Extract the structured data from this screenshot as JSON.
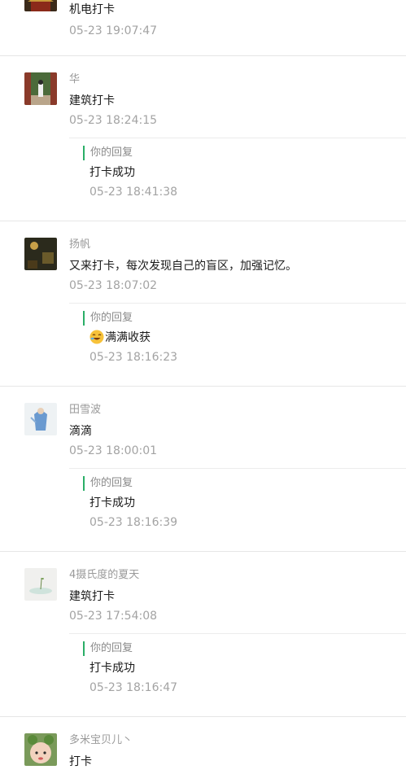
{
  "comments": [
    {
      "nickname": "",
      "text": "机电打卡",
      "time": "05-23 19:07:47",
      "avatar": "palace-avatar"
    },
    {
      "nickname": "华",
      "text": "建筑打卡",
      "time": "05-23 18:24:15",
      "reply": {
        "label": "你的回复",
        "text": "打卡成功",
        "time": "05-23 18:41:38"
      },
      "avatar": "corridor-avatar"
    },
    {
      "nickname": "扬帆",
      "text": "又来打卡，每次发现自己的盲区，加强记忆。",
      "time": "05-23 18:07:02",
      "reply": {
        "label": "你的回复",
        "text": "满满收获",
        "emoji": "laughing-emoji-icon",
        "time": "05-23 18:16:23"
      },
      "avatar": "night-avatar"
    },
    {
      "nickname": "田雪波",
      "text": "滴滴",
      "time": "05-23 18:00:01",
      "reply": {
        "label": "你的回复",
        "text": "打卡成功",
        "time": "05-23 18:16:39"
      },
      "avatar": "illustration-avatar"
    },
    {
      "nickname": "4摄氏度的夏天",
      "text": "建筑打卡",
      "time": "05-23 17:54:08",
      "reply": {
        "label": "你的回复",
        "text": "打卡成功",
        "time": "05-23 18:16:47"
      },
      "avatar": "plant-avatar"
    },
    {
      "nickname": "多米宝贝儿丶",
      "text": "打卡",
      "time": "",
      "avatar": "child-avatar"
    }
  ],
  "colors": {
    "reply_bar": "#2aae67",
    "muted": "#a3a3a3",
    "divider": "#e6e6e6"
  }
}
